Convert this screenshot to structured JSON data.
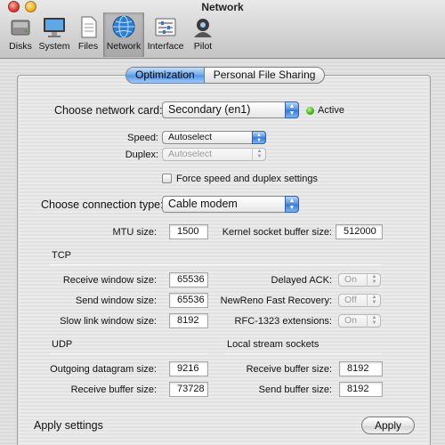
{
  "window": {
    "title": "Network"
  },
  "toolbar": {
    "items": [
      {
        "label": "Disks",
        "icon": "disk-icon"
      },
      {
        "label": "System",
        "icon": "monitor-icon"
      },
      {
        "label": "Files",
        "icon": "document-icon"
      },
      {
        "label": "Network",
        "icon": "globe-icon",
        "selected": true
      },
      {
        "label": "Interface",
        "icon": "sliders-icon"
      },
      {
        "label": "Pilot",
        "icon": "pilot-icon"
      }
    ]
  },
  "tabs": [
    {
      "label": "Optimization",
      "active": true
    },
    {
      "label": "Personal File Sharing",
      "active": false
    }
  ],
  "network_card": {
    "label": "Choose network card:",
    "value": "Secondary (en1)",
    "status": "Active",
    "status_color": "#3fae1a"
  },
  "speed": {
    "label": "Speed:",
    "value": "Autoselect"
  },
  "duplex": {
    "label": "Duplex:",
    "value": "Autoselect",
    "disabled": true
  },
  "force": {
    "label": "Force speed and duplex settings",
    "checked": false
  },
  "connection": {
    "label": "Choose connection type:",
    "value": "Cable modem"
  },
  "mtu": {
    "label": "MTU size:",
    "value": "1500"
  },
  "kernel": {
    "label": "Kernel socket buffer size:",
    "value": "512000"
  },
  "tcp": {
    "heading": "TCP",
    "receive_window": {
      "label": "Receive window size:",
      "value": "65536"
    },
    "send_window": {
      "label": "Send window size:",
      "value": "65536"
    },
    "slow_link": {
      "label": "Slow link window size:",
      "value": "8192"
    },
    "delayed_ack": {
      "label": "Delayed ACK:",
      "value": "On"
    },
    "newreno": {
      "label": "NewReno Fast Recovery:",
      "value": "Off"
    },
    "rfc1323": {
      "label": "RFC-1323 extensions:",
      "value": "On"
    }
  },
  "udp": {
    "heading": "UDP",
    "outgoing": {
      "label": "Outgoing datagram size:",
      "value": "9216"
    },
    "receive": {
      "label": "Receive buffer size:",
      "value": "73728"
    }
  },
  "local": {
    "heading": "Local stream sockets",
    "receive": {
      "label": "Receive buffer size:",
      "value": "8192"
    },
    "send": {
      "label": "Send buffer size:",
      "value": "8192"
    }
  },
  "apply": {
    "label": "Apply settings",
    "button": "Apply"
  },
  "colors": {
    "accent": "#5196e6",
    "active_indicator": "#3fae1a"
  }
}
